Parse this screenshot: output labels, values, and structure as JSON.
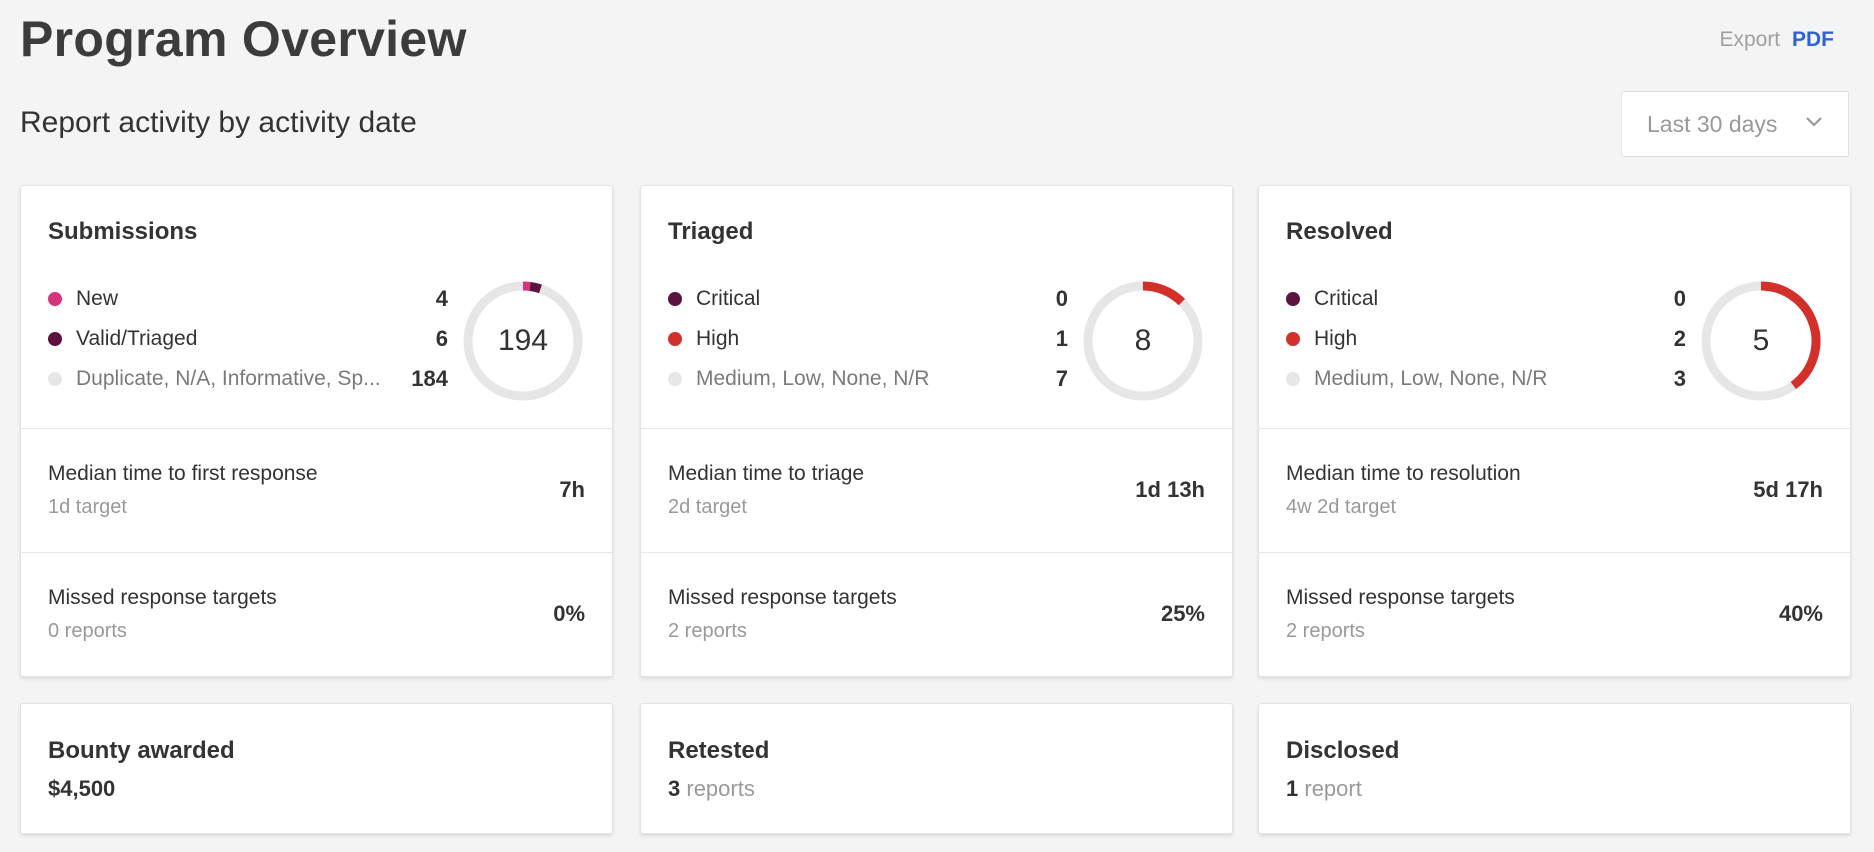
{
  "page": {
    "title": "Program Overview",
    "subtitle": "Report activity by activity date"
  },
  "export": {
    "label": "Export",
    "pdf": "PDF"
  },
  "range": {
    "selected": "Last 30 days"
  },
  "colors": {
    "new": "#d6357d",
    "critical": "#5b1340",
    "high": "#d3302b",
    "muted": "#e6e6e6",
    "link": "#2e63d8"
  },
  "cards": [
    {
      "title": "Submissions",
      "legend": [
        {
          "label": "New",
          "value": "4",
          "color": "#d6357d"
        },
        {
          "label": "Valid/Triaged",
          "value": "6",
          "color": "#5b1340"
        },
        {
          "label": "Duplicate, N/A, Informative, Sp...",
          "value": "184",
          "color": "#e6e6e6"
        }
      ],
      "total": "194",
      "metric1": {
        "label": "Median time to first response",
        "sub": "1d target",
        "value": "7h"
      },
      "metric2": {
        "label": "Missed response targets",
        "sub": "0 reports",
        "value": "0%"
      }
    },
    {
      "title": "Triaged",
      "legend": [
        {
          "label": "Critical",
          "value": "0",
          "color": "#5b1340"
        },
        {
          "label": "High",
          "value": "1",
          "color": "#d3302b"
        },
        {
          "label": "Medium, Low, None, N/R",
          "value": "7",
          "color": "#e6e6e6"
        }
      ],
      "total": "8",
      "metric1": {
        "label": "Median time to triage",
        "sub": "2d target",
        "value": "1d 13h"
      },
      "metric2": {
        "label": "Missed response targets",
        "sub": "2 reports",
        "value": "25%"
      }
    },
    {
      "title": "Resolved",
      "legend": [
        {
          "label": "Critical",
          "value": "0",
          "color": "#5b1340"
        },
        {
          "label": "High",
          "value": "2",
          "color": "#d3302b"
        },
        {
          "label": "Medium, Low, None, N/R",
          "value": "3",
          "color": "#e6e6e6"
        }
      ],
      "total": "5",
      "metric1": {
        "label": "Median time to resolution",
        "sub": "4w 2d target",
        "value": "5d 17h"
      },
      "metric2": {
        "label": "Missed response targets",
        "sub": "2 reports",
        "value": "40%"
      }
    }
  ],
  "summary": [
    {
      "title": "Bounty awarded",
      "value": "$4,500",
      "unit": ""
    },
    {
      "title": "Retested",
      "value": "3",
      "unit": "reports"
    },
    {
      "title": "Disclosed",
      "value": "1",
      "unit": "report"
    }
  ]
}
